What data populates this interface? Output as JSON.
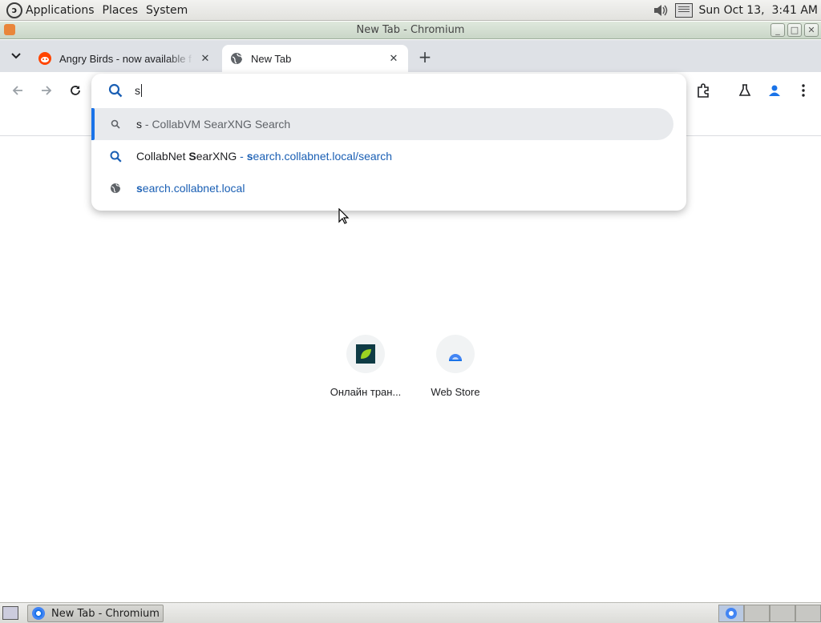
{
  "top_panel": {
    "menus": [
      "Applications",
      "Places",
      "System"
    ],
    "clock": "Sun Oct 13,  3:41 AM"
  },
  "window": {
    "title": "New Tab - Chromium"
  },
  "tabs": [
    {
      "label": "Angry Birds - now available f",
      "favicon": "reddit-icon",
      "active": false
    },
    {
      "label": "New Tab",
      "favicon": "globe-icon",
      "active": true
    }
  ],
  "omnibox": {
    "input_value": "s",
    "suggestions": [
      {
        "icon": "search-icon",
        "match": "s",
        "rest": " - CollabVM SearXNG Search",
        "selected": true
      },
      {
        "icon": "search-icon",
        "title_pre": "CollabNet ",
        "title_bold": "S",
        "title_post": "earXNG",
        "sep": " - ",
        "url_bold": "s",
        "url_rest": "earch.collabnet.local/search",
        "selected": false
      },
      {
        "icon": "globe-icon",
        "url_bold": "s",
        "url_rest": "earch.collabnet.local",
        "selected": false
      }
    ]
  },
  "shortcuts": [
    {
      "label": "Онлайн тран...",
      "icon": "green-leaf-tile-icon"
    },
    {
      "label": "Web Store",
      "icon": "web-store-icon"
    }
  ],
  "taskbar": {
    "task_label": "New Tab - Chromium"
  },
  "colors": {
    "accent": "#1a73e8",
    "tab_strip": "#dee1e6",
    "suggestion_selected_bg": "#e8eaed"
  }
}
